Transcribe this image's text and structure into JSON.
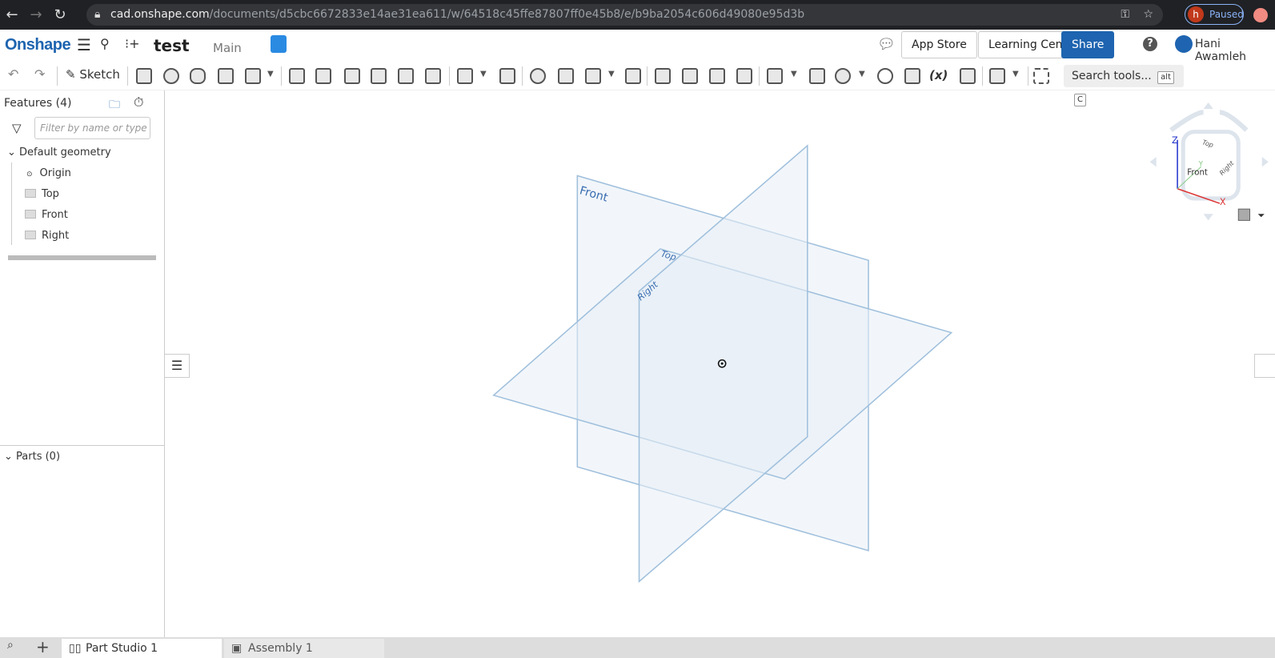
{
  "browser": {
    "url_host": "cad.onshape.com",
    "url_path": "/documents/d5cbc6672833e14ae31ea611/w/64518c45ffe87807ff0e45b8/e/b9ba2054c606d49080e95d3b",
    "profile_initial": "h",
    "profile_status": "Paused"
  },
  "header": {
    "logo": "Onshape",
    "doc_title": "test",
    "branch": "Main",
    "app_store": "App Store",
    "learning_center": "Learning Center",
    "share": "Share",
    "help": "?",
    "user": "Hani Awamleh"
  },
  "toolbar": {
    "sketch": "Sketch",
    "search_placeholder": "Search tools...",
    "kbd1": "alt",
    "kbd2": "C",
    "fx": "(x)"
  },
  "features": {
    "title": "Features (4)",
    "filter_placeholder": "Filter by name or type",
    "group": "Default geometry",
    "items": [
      "Origin",
      "Top",
      "Front",
      "Right"
    ],
    "parts": "Parts (0)"
  },
  "viewport": {
    "planes": {
      "front": "Front",
      "top": "Top",
      "right": "Right"
    },
    "colors": {
      "plane_fill": "#e8eff6",
      "plane_stroke": "#9fbfdc",
      "label": "#3a6db0"
    }
  },
  "viewcube": {
    "faces": [
      "Top",
      "Front",
      "Right"
    ],
    "axes": [
      "X",
      "Y",
      "Z"
    ]
  },
  "tabs": {
    "items": [
      "Part Studio 1",
      "Assembly 1"
    ]
  }
}
